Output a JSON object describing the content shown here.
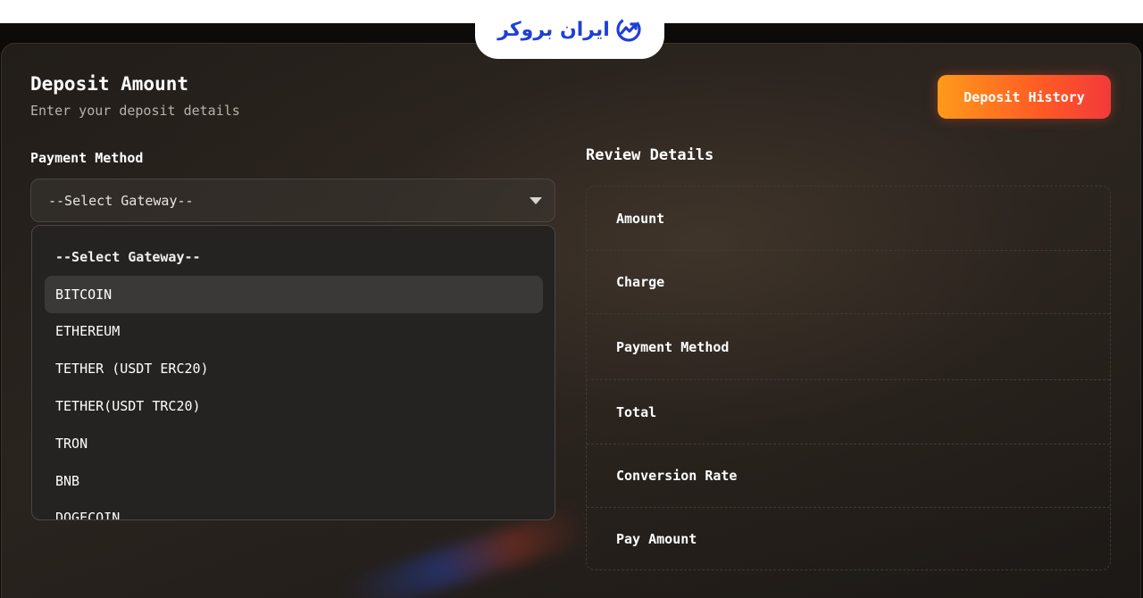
{
  "brand": {
    "logo_text": "ایران بروکر",
    "color": "#1f3fd6"
  },
  "page": {
    "title": "Deposit Amount",
    "subtitle": "Enter your deposit details",
    "history_button": "Deposit History"
  },
  "payment": {
    "label": "Payment Method",
    "selected": "--Select Gateway--",
    "options": [
      "--Select Gateway--",
      "BITCOIN",
      "ETHEREUM",
      "TETHER (USDT ERC20)",
      "TETHER(USDT TRC20)",
      "TRON",
      "BNB",
      "DOGECOIN"
    ],
    "highlighted": "BITCOIN"
  },
  "review": {
    "title": "Review Details",
    "rows": [
      "Amount",
      "Charge",
      "Payment Method",
      "Total",
      "Conversion Rate",
      "Pay Amount"
    ]
  },
  "colors": {
    "accent_start": "#ff9a1a",
    "accent_end": "#f23a3a",
    "background": "#1c1815"
  }
}
